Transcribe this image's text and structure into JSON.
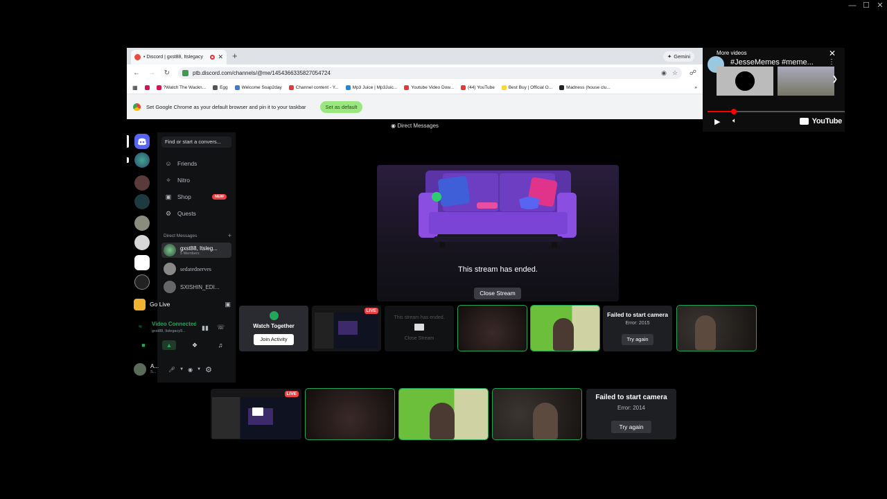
{
  "browser": {
    "tab_title": "• Discord | gxst88, Itslegacy",
    "new_tab": "+",
    "gemini": "Gemini",
    "url": "ptb.discord.com/channels/@me/1454366335827054724",
    "bookmarks": [
      "?Watch The Wackn...",
      "Egg",
      "Welcome Soap2day",
      "Channel content - Y...",
      "Mp3 Juice | Mp3Juic...",
      "Youtube Video Dow...",
      "(44) YouTube",
      "Best Buy | Official O...",
      "Madness (house clu..."
    ],
    "infobar_text": "Set Google Chrome as your default browser and pin it to your taskbar",
    "infobar_button": "Set as default"
  },
  "discord": {
    "header": "Direct Messages",
    "search_placeholder": "Find or start a convers...",
    "nav": [
      {
        "label": "Friends",
        "icon": "friends-icon"
      },
      {
        "label": "Nitro",
        "icon": "nitro-icon"
      },
      {
        "label": "Shop",
        "icon": "shop-icon",
        "badge": "NEW"
      },
      {
        "label": "Quests",
        "icon": "quests-icon"
      }
    ],
    "dm_header": "Direct Messages",
    "dm_add": "+",
    "dms": [
      {
        "name": "gxst88, Itsleg...",
        "sub": "5 Members"
      },
      {
        "name": "sedatednerves",
        "sub": ""
      },
      {
        "name": "SXISHIN_EDI...",
        "sub": ""
      }
    ],
    "go_live": "Go Live",
    "voice_status": "Video Connected",
    "voice_channel": "gxst88, Itslegacy9...",
    "user_name": "A...",
    "user_sub": "S..."
  },
  "stream": {
    "ended_text": "This stream has ended.",
    "close_button": "Close Stream",
    "row1": {
      "watch_together": "Watch Together",
      "join_activity": "Join Activity",
      "live_badge": "LIVE",
      "mini_ended": "This stream has ended.",
      "mini_close": "Close Stream",
      "fail_title": "Failed to start camera",
      "fail_error": "Error: 2015",
      "try_again": "Try again"
    },
    "row2": {
      "live_badge": "LIVE",
      "fail_title": "Failed to start camera",
      "fail_error": "Error: 2014",
      "try_again": "Try again"
    }
  },
  "youtube": {
    "more_videos": "More videos",
    "title": "#JesseMemes #meme...",
    "brand": "YouTube",
    "progress": 0.19
  },
  "colors": {
    "accent_green": "#23a55a",
    "live_red": "#ed4245",
    "discord_blurple": "#5865f2"
  }
}
